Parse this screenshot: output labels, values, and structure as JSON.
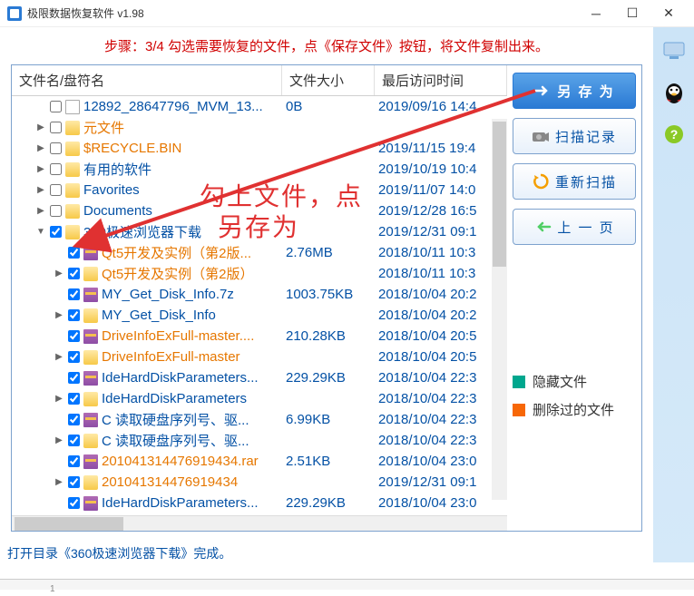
{
  "window": {
    "title": "极限数据恢复软件 v1.98"
  },
  "instruction": "步骤：3/4 勾选需要恢复的文件，点《保存文件》按钮，将文件复制出来。",
  "columns": {
    "name": "文件名/盘符名",
    "size": "文件大小",
    "date": "最后访问时间"
  },
  "rows": [
    {
      "indent": 1,
      "exp": "",
      "chk": false,
      "icon": "file",
      "color": "blue",
      "name": "12892_28647796_MVM_13...",
      "size": "0B",
      "date": "2019/09/16 14:4"
    },
    {
      "indent": 1,
      "exp": ">",
      "chk": false,
      "icon": "folder",
      "color": "orange",
      "name": "元文件",
      "size": "",
      "date": ""
    },
    {
      "indent": 1,
      "exp": ">",
      "chk": false,
      "icon": "folder",
      "color": "orange",
      "name": "$RECYCLE.BIN",
      "size": "",
      "date": "2019/11/15 19:4"
    },
    {
      "indent": 1,
      "exp": ">",
      "chk": false,
      "icon": "folder",
      "color": "blue",
      "name": "有用的软件",
      "size": "",
      "date": "2019/10/19 10:4"
    },
    {
      "indent": 1,
      "exp": ">",
      "chk": false,
      "icon": "folder",
      "color": "blue",
      "name": "Favorites",
      "size": "",
      "date": "2019/11/07 14:0"
    },
    {
      "indent": 1,
      "exp": ">",
      "chk": false,
      "icon": "folder",
      "color": "blue",
      "name": "Documents",
      "size": "",
      "date": "2019/12/28 16:5"
    },
    {
      "indent": 1,
      "exp": "v",
      "chk": true,
      "icon": "folder",
      "color": "blue",
      "name": "360极速浏览器下载",
      "size": "",
      "date": "2019/12/31 09:1"
    },
    {
      "indent": 2,
      "exp": "",
      "chk": true,
      "icon": "rar",
      "color": "orange",
      "name": "Qt5开发及实例（第2版...",
      "size": "2.76MB",
      "date": "2018/10/11 10:3"
    },
    {
      "indent": 2,
      "exp": ">",
      "chk": true,
      "icon": "folder",
      "color": "orange",
      "name": "Qt5开发及实例（第2版）",
      "size": "",
      "date": "2018/10/11 10:3"
    },
    {
      "indent": 2,
      "exp": "",
      "chk": true,
      "icon": "rar",
      "color": "blue",
      "name": "MY_Get_Disk_Info.7z",
      "size": "1003.75KB",
      "date": "2018/10/04 20:2"
    },
    {
      "indent": 2,
      "exp": ">",
      "chk": true,
      "icon": "folder",
      "color": "blue",
      "name": "MY_Get_Disk_Info",
      "size": "",
      "date": "2018/10/04 20:2"
    },
    {
      "indent": 2,
      "exp": "",
      "chk": true,
      "icon": "rar",
      "color": "orange",
      "name": "DriveInfoExFull-master....",
      "size": "210.28KB",
      "date": "2018/10/04 20:5"
    },
    {
      "indent": 2,
      "exp": ">",
      "chk": true,
      "icon": "folder",
      "color": "orange",
      "name": "DriveInfoExFull-master",
      "size": "",
      "date": "2018/10/04 20:5"
    },
    {
      "indent": 2,
      "exp": "",
      "chk": true,
      "icon": "rar",
      "color": "blue",
      "name": "IdeHardDiskParameters...",
      "size": "229.29KB",
      "date": "2018/10/04 22:3"
    },
    {
      "indent": 2,
      "exp": ">",
      "chk": true,
      "icon": "folder",
      "color": "blue",
      "name": "IdeHardDiskParameters",
      "size": "",
      "date": "2018/10/04 22:3"
    },
    {
      "indent": 2,
      "exp": "",
      "chk": true,
      "icon": "rar",
      "color": "blue",
      "name": "C   读取硬盘序列号、驱...",
      "size": "6.99KB",
      "date": "2018/10/04 22:3"
    },
    {
      "indent": 2,
      "exp": ">",
      "chk": true,
      "icon": "folder",
      "color": "blue",
      "name": "C   读取硬盘序列号、驱...",
      "size": "",
      "date": "2018/10/04 22:3"
    },
    {
      "indent": 2,
      "exp": "",
      "chk": true,
      "icon": "rar",
      "color": "orange",
      "name": "201041314476919434.rar",
      "size": "2.51KB",
      "date": "2018/10/04 23:0"
    },
    {
      "indent": 2,
      "exp": ">",
      "chk": true,
      "icon": "folder",
      "color": "orange",
      "name": "201041314476919434",
      "size": "",
      "date": "2019/12/31 09:1"
    },
    {
      "indent": 2,
      "exp": "",
      "chk": true,
      "icon": "rar",
      "color": "blue",
      "name": "IdeHardDiskParameters...",
      "size": "229.29KB",
      "date": "2018/10/04 23:0"
    }
  ],
  "buttons": {
    "save": "另 存 为",
    "scanlog": "扫描记录",
    "rescan": "重新扫描",
    "back": "上 一 页"
  },
  "legend": {
    "hidden": "隐藏文件",
    "deleted": "删除过的文件",
    "hidden_color": "#00a78e",
    "deleted_color": "#f76707"
  },
  "status": "打开目录《360极速浏览器下载》完成。",
  "annotation": {
    "line1": "勾上文件，点",
    "line2": "另存为"
  },
  "bottom_num": "1"
}
